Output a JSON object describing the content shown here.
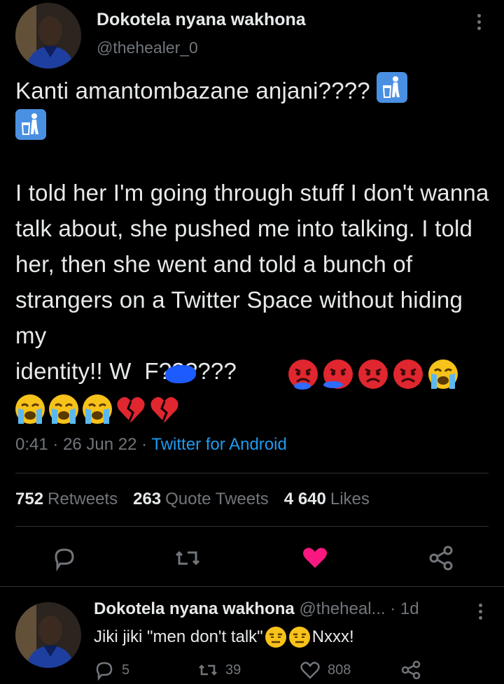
{
  "tweet": {
    "author_name": "Dokotela nyana wakhona",
    "author_handle": "@thehealer_0",
    "line1": "Kanti amantombazane anjani????",
    "paragraph": "I told her I'm going through stuff I don't wanna talk about, she pushed me into talking. I told her, then she went and told a bunch of strangers on a Twitter Space without hiding my",
    "last_line": "identity!! W  F??????",
    "time": "0:41",
    "date": "26 Jun 22",
    "source": "Twitter for Android",
    "separator": "·"
  },
  "stats": {
    "retweets_count": "752",
    "retweets_label": "Retweets",
    "quotes_count": "263",
    "quotes_label": "Quote Tweets",
    "likes_count": "4 640",
    "likes_label": "Likes"
  },
  "colors": {
    "background": "#000000",
    "text": "#e7e9ea",
    "muted": "#71767b",
    "link": "#1d9bf0",
    "like": "#f91880",
    "divider": "#2f3336"
  },
  "icons": [
    "reply-icon",
    "retweet-icon",
    "like-icon-filled",
    "share-icon",
    "more-icon",
    "wastebasket-emoji",
    "angry-face-emoji",
    "crying-face-emoji",
    "broken-heart-emoji",
    "unamused-face-emoji"
  ],
  "reply": {
    "author_name": "Dokotela nyana wakhona",
    "author_handle": "@theheal...",
    "time_ago": "· 1d",
    "text_start": "Jiki jiki \"men don't talk\"",
    "text_end": "Nxxx!",
    "reply_count": "5",
    "retweet_count": "39",
    "like_count": "808"
  }
}
